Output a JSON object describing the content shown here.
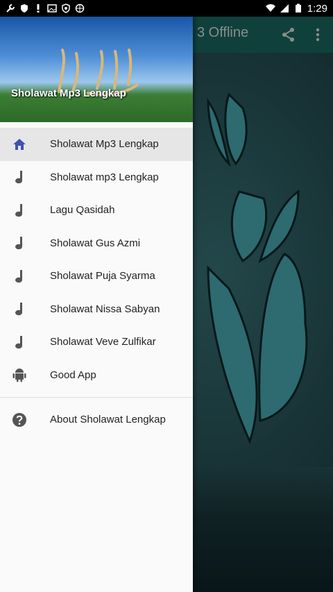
{
  "status_bar": {
    "time": "1:29",
    "left_icons": [
      "wrench-icon",
      "shield-icon",
      "exclamation-icon",
      "image-icon",
      "vpn-icon",
      "globe-icon"
    ],
    "right_icons": [
      "wifi-icon",
      "signal-icon",
      "battery-icon"
    ]
  },
  "app": {
    "title_visible": "3 Offline",
    "actions": [
      "share-icon",
      "overflow-menu-icon"
    ]
  },
  "drawer": {
    "header_title": "Sholawat Mp3 Lengkap",
    "items": [
      {
        "label": "Sholawat Mp3 Lengkap",
        "icon": "home-icon",
        "selected": true
      },
      {
        "label": "Sholawat mp3 Lengkap",
        "icon": "music-note-icon"
      },
      {
        "label": "Lagu Qasidah",
        "icon": "music-note-icon"
      },
      {
        "label": "Sholawat Gus Azmi",
        "icon": "music-note-icon"
      },
      {
        "label": "Sholawat Puja Syarma",
        "icon": "music-note-icon"
      },
      {
        "label": "Sholawat Nissa Sabyan",
        "icon": "music-note-icon"
      },
      {
        "label": "Sholawat Veve Zulfikar",
        "icon": "music-note-icon"
      },
      {
        "label": "Good App",
        "icon": "android-icon"
      }
    ],
    "secondary_items": [
      {
        "label": "About Sholawat Lengkap",
        "icon": "help-icon"
      }
    ]
  },
  "colors": {
    "toolbar": "#1c6f66",
    "selected_icon": "#3f51b5",
    "icon_default": "#555555"
  }
}
